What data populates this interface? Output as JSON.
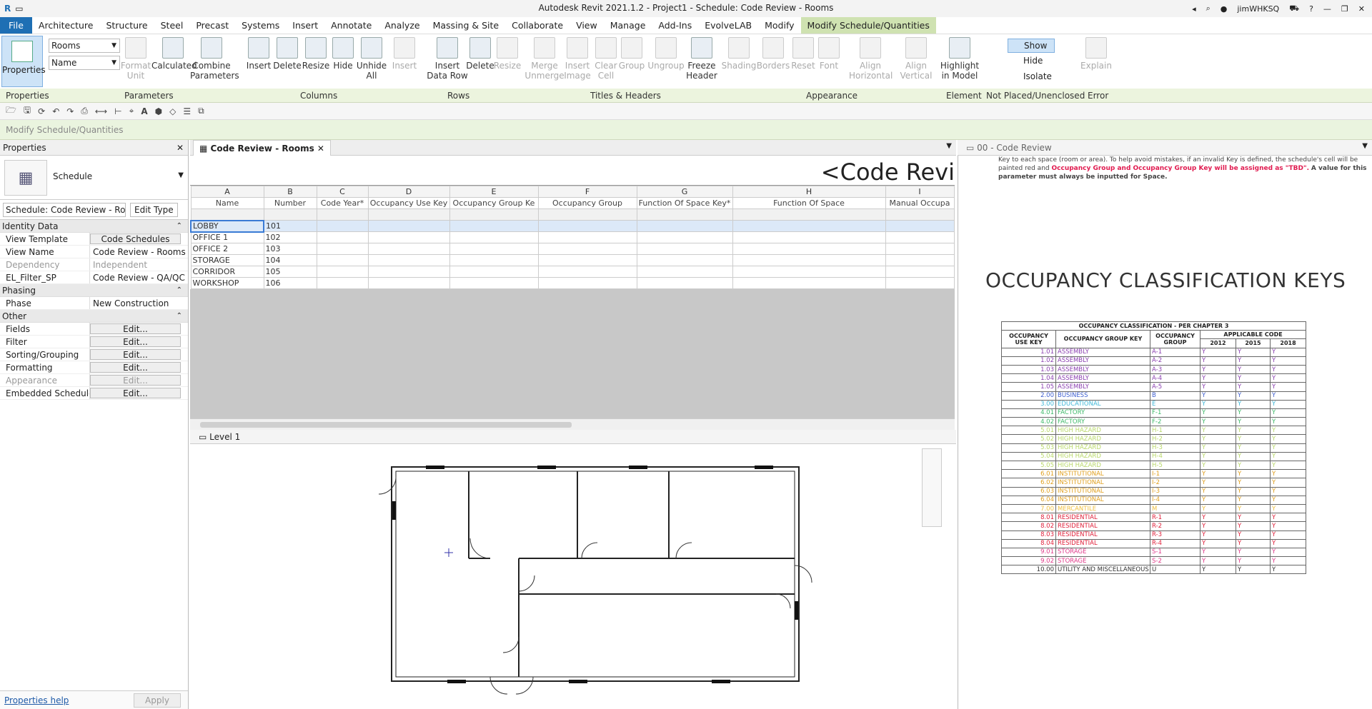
{
  "window": {
    "title": "Autodesk Revit 2021.1.2 - Project1 - Schedule: Code Review - Rooms",
    "user": "jimWHKSQ"
  },
  "menu": [
    "File",
    "Architecture",
    "Structure",
    "Steel",
    "Precast",
    "Systems",
    "Insert",
    "Annotate",
    "Analyze",
    "Massing & Site",
    "Collaborate",
    "View",
    "Manage",
    "Add-Ins",
    "EvolveLAB",
    "Modify",
    "Modify Schedule/Quantities"
  ],
  "ribbon": {
    "properties_label": "Properties",
    "param_dropdown_1": "Rooms",
    "param_dropdown_2": "Name",
    "buttons": [
      {
        "label": "Format\nUnit",
        "enabled": false
      },
      {
        "label": "Calculated",
        "enabled": true
      },
      {
        "label": "Combine\nParameters",
        "enabled": true
      },
      {
        "label": "Insert",
        "enabled": true
      },
      {
        "label": "Delete",
        "enabled": true
      },
      {
        "label": "Resize",
        "enabled": true
      },
      {
        "label": "Hide",
        "enabled": true
      },
      {
        "label": "Unhide\nAll",
        "enabled": true
      },
      {
        "label": "Insert",
        "enabled": false
      },
      {
        "label": "Insert\nData Row",
        "enabled": true
      },
      {
        "label": "Delete",
        "enabled": true
      },
      {
        "label": "Resize",
        "enabled": false
      },
      {
        "label": "Merge\nUnmerge",
        "enabled": false
      },
      {
        "label": "Insert\nImage",
        "enabled": false
      },
      {
        "label": "Clear\nCell",
        "enabled": false
      },
      {
        "label": "Group",
        "enabled": false
      },
      {
        "label": "Ungroup",
        "enabled": false
      },
      {
        "label": "Freeze\nHeader",
        "enabled": true
      },
      {
        "label": "Shading",
        "enabled": false
      },
      {
        "label": "Borders",
        "enabled": false
      },
      {
        "label": "Reset",
        "enabled": false
      },
      {
        "label": "Font",
        "enabled": false
      },
      {
        "label": "Align\nHorizontal",
        "enabled": false
      },
      {
        "label": "Align\nVertical",
        "enabled": false
      },
      {
        "label": "Highlight\nin Model",
        "enabled": true
      },
      {
        "label": "Explain",
        "enabled": false
      }
    ],
    "show_hide": [
      "Show",
      "Hide",
      "Isolate"
    ],
    "group_labels": [
      "Properties",
      "Parameters",
      "Columns",
      "Rows",
      "Titles & Headers",
      "Appearance",
      "Element",
      "Not Placed/Unenclosed",
      "Error"
    ]
  },
  "context_bar": "Modify Schedule/Quantities",
  "properties": {
    "title": "Properties",
    "type_name": "Schedule",
    "selector": "Schedule: Code Review - Roo",
    "edit_type": "Edit Type",
    "sections": [
      {
        "name": "Identity Data",
        "rows": [
          {
            "k": "View Template",
            "v": "Code Schedules",
            "btn": true
          },
          {
            "k": "View Name",
            "v": "Code Review - Rooms"
          },
          {
            "k": "Dependency",
            "v": "Independent",
            "dis": true
          },
          {
            "k": "EL_Filter_SP",
            "v": "Code Review - QA/QC"
          }
        ]
      },
      {
        "name": "Phasing",
        "rows": [
          {
            "k": "Phase",
            "v": "New Construction"
          }
        ]
      },
      {
        "name": "Other",
        "rows": [
          {
            "k": "Fields",
            "v": "Edit...",
            "btn": true
          },
          {
            "k": "Filter",
            "v": "Edit...",
            "btn": true
          },
          {
            "k": "Sorting/Grouping",
            "v": "Edit...",
            "btn": true
          },
          {
            "k": "Formatting",
            "v": "Edit...",
            "btn": true
          },
          {
            "k": "Appearance",
            "v": "Edit...",
            "btn": true,
            "dis": true
          },
          {
            "k": "Embedded Schedule",
            "v": "Edit...",
            "btn": true
          }
        ]
      }
    ],
    "help": "Properties help",
    "apply": "Apply"
  },
  "tabs": {
    "schedule": "Code Review - Rooms",
    "plan": "Level 1",
    "right": "00 - Code Review"
  },
  "schedule": {
    "title": "<Code Revi",
    "letters": [
      "A",
      "B",
      "C",
      "D",
      "E",
      "F",
      "G",
      "H",
      "I"
    ],
    "headers": [
      "Name",
      "Number",
      "Code Year*",
      "Occupancy Use Key",
      "Occupancy Group Ke",
      "Occupancy Group",
      "Function Of Space Key*",
      "Function Of Space",
      "Manual Occupa"
    ],
    "rows": [
      [
        "LOBBY",
        "101"
      ],
      [
        "OFFICE 1",
        "102"
      ],
      [
        "OFFICE 2",
        "103"
      ],
      [
        "STORAGE",
        "104"
      ],
      [
        "CORRIDOR",
        "105"
      ],
      [
        "WORKSHOP",
        "106"
      ]
    ]
  },
  "right_panel": {
    "note_pre": "Key to each space (room or area). To help avoid mistakes, if an invalid Key is defined, the schedule's cell will be painted red and",
    "note_red": "Occupancy Group and Occupancy Group Key will be assigned as \"TBD\".",
    "note_post": "A value for this parameter must always be inputted for Space.",
    "heading": "OCCUPANCY CLASSIFICATION KEYS",
    "table_title": "OCCUPANCY CLASSIFICATION - PER CHAPTER 3",
    "cols": [
      "OCCUPANCY USE KEY",
      "OCCUPANCY GROUP KEY",
      "OCCUPANCY GROUP",
      "APPLICABLE CODE"
    ],
    "years": [
      "2012",
      "2015",
      "2018"
    ],
    "rows": [
      [
        "1.01",
        "ASSEMBLY",
        "A-1",
        "#8a3fb0"
      ],
      [
        "1.02",
        "ASSEMBLY",
        "A-2",
        "#8a3fb0"
      ],
      [
        "1.03",
        "ASSEMBLY",
        "A-3",
        "#8a3fb0"
      ],
      [
        "1.04",
        "ASSEMBLY",
        "A-4",
        "#8a3fb0"
      ],
      [
        "1.05",
        "ASSEMBLY",
        "A-5",
        "#8a3fb0"
      ],
      [
        "2.00",
        "BUSINESS",
        "B",
        "#3f5fd0"
      ],
      [
        "3.00",
        "EDUCATIONAL",
        "E",
        "#3fb8d8"
      ],
      [
        "4.01",
        "FACTORY",
        "F-1",
        "#3fba6a"
      ],
      [
        "4.02",
        "FACTORY",
        "F-2",
        "#3fba6a"
      ],
      [
        "5.01",
        "HIGH HAZARD",
        "H-1",
        "#b9d86a"
      ],
      [
        "5.02",
        "HIGH HAZARD",
        "H-2",
        "#b9d86a"
      ],
      [
        "5.03",
        "HIGH HAZARD",
        "H-3",
        "#b9d86a"
      ],
      [
        "5.04",
        "HIGH HAZARD",
        "H-4",
        "#b9d86a"
      ],
      [
        "5.05",
        "HIGH HAZARD",
        "H-5",
        "#b9d86a"
      ],
      [
        "6.01",
        "INSTITUTIONAL",
        "I-1",
        "#e0a020"
      ],
      [
        "6.02",
        "INSTITUTIONAL",
        "I-2",
        "#e0a020"
      ],
      [
        "6.03",
        "INSTITUTIONAL",
        "I-3",
        "#e0a020"
      ],
      [
        "6.04",
        "INSTITUTIONAL",
        "I-4",
        "#e0a020"
      ],
      [
        "7.00",
        "MERCANTILE",
        "M",
        "#f0c040"
      ],
      [
        "8.01",
        "RESIDENTIAL",
        "R-1",
        "#e0203a"
      ],
      [
        "8.02",
        "RESIDENTIAL",
        "R-2",
        "#e0203a"
      ],
      [
        "8.03",
        "RESIDENTIAL",
        "R-3",
        "#e0203a"
      ],
      [
        "8.04",
        "RESIDENTIAL",
        "R-4",
        "#e0203a"
      ],
      [
        "9.01",
        "STORAGE",
        "S-1",
        "#e03a8a"
      ],
      [
        "9.02",
        "STORAGE",
        "S-2",
        "#e03a8a"
      ],
      [
        "10.00",
        "UTILITY AND MISCELLANEOUS",
        "U",
        "#333333"
      ]
    ],
    "y": "Y"
  }
}
